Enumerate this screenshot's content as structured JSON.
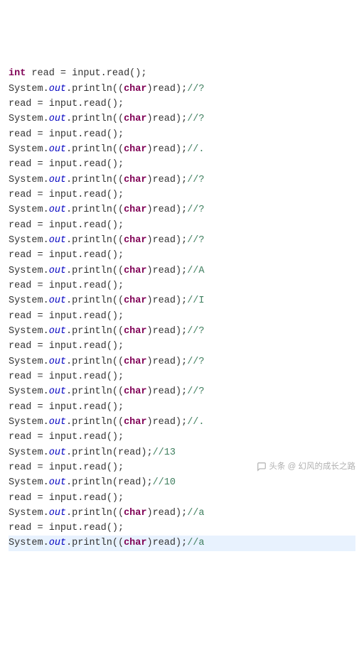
{
  "tokens": {
    "int": "int",
    "char": "char",
    "read_var": "read",
    "equals": " = ",
    "input": "input",
    "dot": ".",
    "read_call": "read",
    "lparen": "(",
    "rparen": ")",
    "semi": ";",
    "system": "System",
    "out": "out",
    "println": "println",
    "cast_open": "((",
    "cast_close": ")"
  },
  "first_line_comment": "//?",
  "pairs": [
    {
      "comment": "//?",
      "cast": true
    },
    {
      "comment": "//.",
      "cast": true
    },
    {
      "comment": "//?",
      "cast": true
    },
    {
      "comment": "//?",
      "cast": true
    },
    {
      "comment": "//?",
      "cast": true
    },
    {
      "comment": "//A",
      "cast": true
    },
    {
      "comment": "//I",
      "cast": true
    },
    {
      "comment": "//?",
      "cast": true
    },
    {
      "comment": "//?",
      "cast": true
    },
    {
      "comment": "//?",
      "cast": true
    },
    {
      "comment": "//.",
      "cast": true
    },
    {
      "comment": "//13",
      "cast": false
    },
    {
      "comment": "//10",
      "cast": false
    },
    {
      "comment": "//a",
      "cast": true
    }
  ],
  "last_line": {
    "comment": "//a",
    "cast": true,
    "highlighted": true
  },
  "watermark": "头条 @ 幻风的成长之路"
}
